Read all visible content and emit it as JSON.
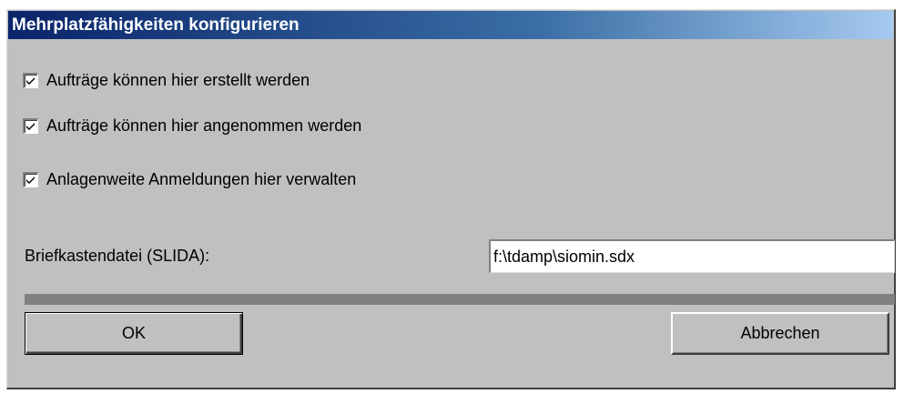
{
  "dialog": {
    "title": "Mehrplatzfähigkeiten konfigurieren"
  },
  "options": [
    {
      "label": "Aufträge können hier erstellt werden",
      "checked": true
    },
    {
      "label": "Aufträge können hier angenommen werden",
      "checked": true
    },
    {
      "label": "Anlagenweite Anmeldungen hier verwalten",
      "checked": true
    }
  ],
  "mailbox": {
    "label": "Briefkastendatei (SLIDA):",
    "value": "f:\\tdamp\\siomin.sdx"
  },
  "buttons": {
    "ok_label": "OK",
    "cancel_label": "Abbrechen"
  },
  "colors": {
    "title_start": "#0a246a",
    "title_end": "#a6caf0",
    "face": "#c0c0c0",
    "progress_track": "#808080"
  },
  "icons": {
    "checkmark": "checkmark-icon"
  }
}
